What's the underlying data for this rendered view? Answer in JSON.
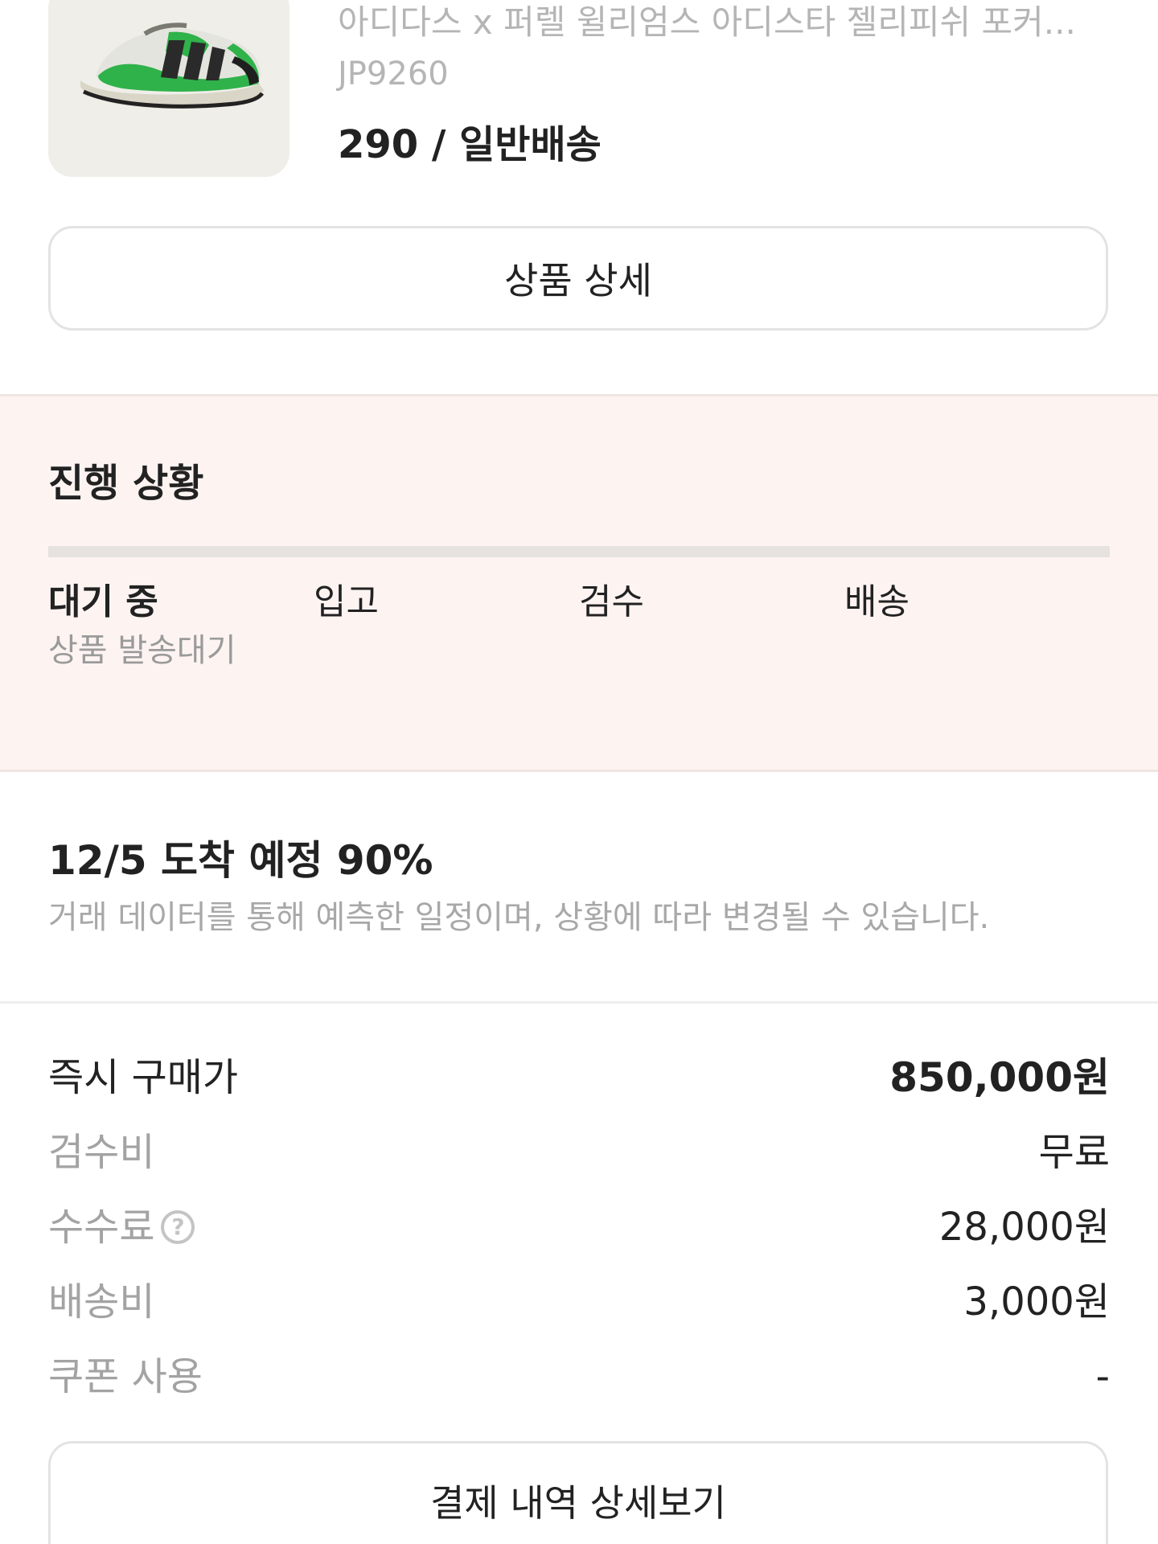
{
  "product": {
    "image_icon": "sneaker-image",
    "name": "아디다스 x 퍼렐 윌리엄스 아디스타 젤리피쉬 포커...",
    "code": "JP9260",
    "option": "290 / 일반배송",
    "detail_button": "상품 상세"
  },
  "progress": {
    "title": "진행 상황",
    "fraction": 0.0,
    "steps": [
      {
        "label": "대기 중",
        "active": true
      },
      {
        "label": "입고",
        "active": false
      },
      {
        "label": "검수",
        "active": false
      },
      {
        "label": "배송",
        "active": false
      }
    ],
    "current_sub": "상품 발송대기"
  },
  "arrival": {
    "title": "12/5 도착 예정 90%",
    "note": "거래 데이터를 통해 예측한 일정이며, 상황에 따라 변경될 수 있습니다."
  },
  "payment": {
    "rows": [
      {
        "label": "즉시 구매가",
        "value": "850,000원"
      },
      {
        "label": "검수비",
        "value": "무료"
      },
      {
        "label": "수수료",
        "value": "28,000원",
        "help_icon": "question-circle-icon",
        "help_glyph": "?"
      },
      {
        "label": "배송비",
        "value": "3,000원"
      },
      {
        "label": "쿠폰 사용",
        "value": "-"
      }
    ],
    "detail_button": "결제 내역 상세보기"
  },
  "colors": {
    "progress_bg": "#fdf4f2",
    "text_primary": "#222222",
    "text_secondary": "#a3a3a3",
    "shoe_green": "#2fb24a"
  }
}
